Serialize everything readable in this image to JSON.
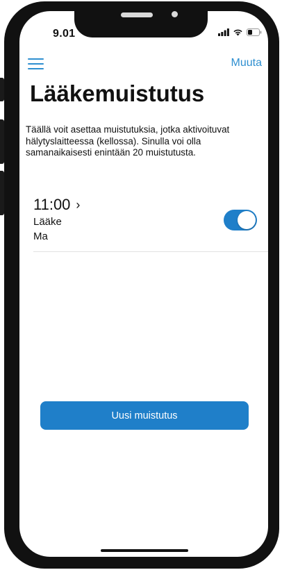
{
  "status_bar": {
    "time": "9.01",
    "icons": [
      "signal-icon",
      "wifi-icon",
      "battery-icon"
    ]
  },
  "header": {
    "menu_icon": "hamburger-menu-icon",
    "edit_label": "Muuta"
  },
  "page": {
    "title": "Lääkemuistutus",
    "intro": "Täällä voit asettaa muistutuksia, jotka aktivoituvat hälytyslaitteessa (kellossa). Sinulla voi olla samanaikaisesti enintään 20 muistutusta."
  },
  "reminders": [
    {
      "time": "11:00",
      "chevron": "›",
      "name": "Lääke",
      "days": "Ma",
      "enabled": true
    }
  ],
  "actions": {
    "new_reminder_label": "Uusi muistutus"
  },
  "colors": {
    "accent": "#1f7fc9",
    "link": "#2e8fd0",
    "text": "#111111",
    "frame": "#111111"
  }
}
